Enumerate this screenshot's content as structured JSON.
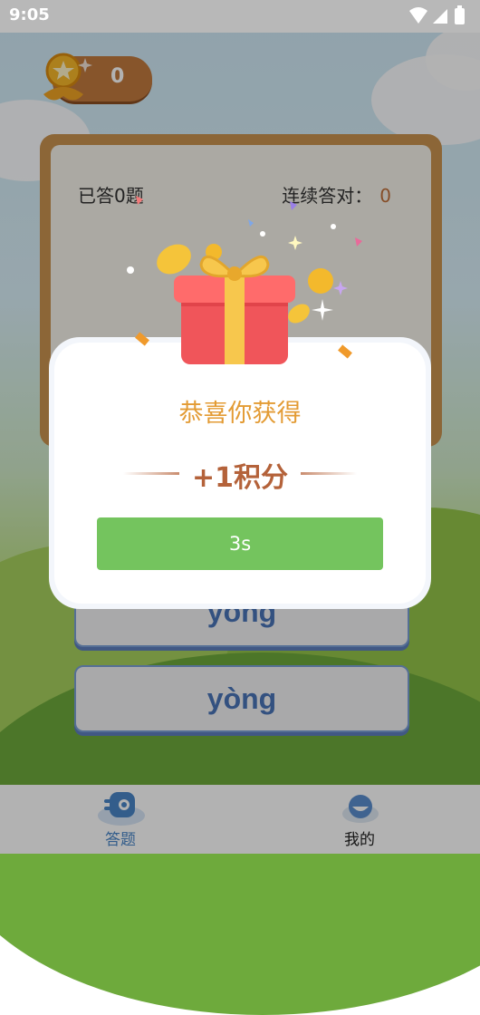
{
  "status_bar": {
    "time": "9:05"
  },
  "coins": {
    "count": "0"
  },
  "quiz": {
    "answered_label": "已答0题",
    "streak_label": "连续答对：",
    "streak_count": "0"
  },
  "options": [
    {
      "label": "yong"
    },
    {
      "label": "yòng"
    }
  ],
  "reward_dialog": {
    "title": "恭喜你获得",
    "reward": "+1积分",
    "countdown": "3s"
  },
  "nav": {
    "items": [
      {
        "label": "答题",
        "active": true,
        "icon": "quiz-icon"
      },
      {
        "label": "我的",
        "active": false,
        "icon": "profile-icon"
      }
    ]
  },
  "colors": {
    "accent_orange": "#e39b34",
    "reward_brown": "#b4623a",
    "button_green": "#74c45e",
    "nav_active": "#4a86c8",
    "option_text": "#4a74b8"
  }
}
